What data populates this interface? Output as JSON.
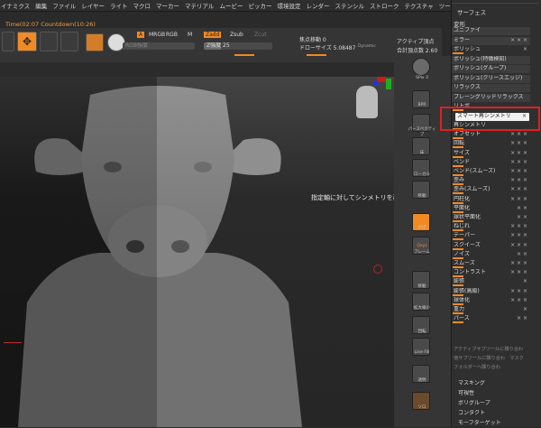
{
  "menubar": {
    "items": [
      "イナミクス",
      "編集",
      "ファイル",
      "レイヤー",
      "ライト",
      "マクロ",
      "マーカー",
      "マテリアル",
      "ムービー",
      "ピッカー",
      "環境設定",
      "レンダー",
      "ステンシル",
      "ストローク",
      "テクスチャ",
      "ツール"
    ]
  },
  "timer": "Time(02:07 Countdown(10:26)",
  "toolbar": {
    "a_label": "A",
    "mrgb": "MRGB",
    "rgb": "RGB",
    "m": "M",
    "zadd": "Zadd",
    "zsub": "Zsub",
    "zcut": "Zcut",
    "rgb_intensity": "RGB強度",
    "z_intensity": "Z強度 25",
    "z_intensity_value": 25,
    "focal_shift": "焦点移動 0",
    "focal_shift_value": 0,
    "draw_size": "ドローサイズ 5.08487",
    "draw_size_value": 5.08487,
    "dynamic": "Dynamic",
    "active_points": "アクティブ頂点",
    "total_points": "合計頂点数 2.60",
    "left_tools": [
      "Edit",
      "Move"
    ]
  },
  "shelf": {
    "spix": "SPix 3",
    "buttons": [
      "BPR",
      "パースペクティブ",
      "床",
      "ローカル",
      "移動",
      "XYZ",
      "フレーム",
      "移動",
      "拡大縮小",
      "回転",
      "Line Fill",
      "透明",
      "ソロ"
    ],
    "xyz_label": "Qxyz"
  },
  "tray": {
    "header": "サーフェス",
    "section": "変形",
    "items": [
      {
        "label": "ユニファイ",
        "style": "bar",
        "dots": ""
      },
      {
        "label": "ミラー",
        "style": "bar",
        "dots": "× × ×"
      },
      {
        "label": "ポリッシュ",
        "style": "plain",
        "dots": "×"
      },
      {
        "label": "ポリッシュ(特徴検知)",
        "style": "bar",
        "dots": ""
      },
      {
        "label": "ポリッシュ(グループ)",
        "style": "bar",
        "dots": ""
      },
      {
        "label": "ポリッシュ(クリースエッジ)",
        "style": "bar",
        "dots": ""
      },
      {
        "label": "リラックス",
        "style": "bar",
        "dots": ""
      },
      {
        "label": "プレーングリッドリラックス",
        "style": "bar",
        "dots": ""
      },
      {
        "label": "リトポ",
        "style": "plain",
        "dots": ""
      },
      {
        "label": "スマート再シンメトリ",
        "style": "highlight",
        "dots": "×"
      },
      {
        "label": "再シンメトリ",
        "style": "plain",
        "dots": ""
      },
      {
        "label": "オフセット",
        "style": "plain",
        "dots": "× × ×"
      },
      {
        "label": "回転",
        "style": "plain",
        "dots": "× × ×"
      },
      {
        "label": "サイズ",
        "style": "plain",
        "dots": "× × ×"
      },
      {
        "label": "ベンド",
        "style": "plain",
        "dots": "× × ×"
      },
      {
        "label": "ベンド(スムーズ)",
        "style": "plain",
        "dots": "× × ×"
      },
      {
        "label": "歪み",
        "style": "plain",
        "dots": "× × ×"
      },
      {
        "label": "歪み(スムーズ)",
        "style": "plain",
        "dots": "× × ×"
      },
      {
        "label": "円柱化",
        "style": "plain",
        "dots": "× × ×"
      },
      {
        "label": "平面化",
        "style": "plain",
        "dots": "× ×"
      },
      {
        "label": "球状平面化",
        "style": "plain",
        "dots": "× ×"
      },
      {
        "label": "ねじれ",
        "style": "plain",
        "dots": "× × ×"
      },
      {
        "label": "テーパー",
        "style": "plain",
        "dots": "× × ×"
      },
      {
        "label": "スクイーズ",
        "style": "plain",
        "dots": "× × ×"
      },
      {
        "label": "ノイズ",
        "style": "plain",
        "dots": "× ×"
      },
      {
        "label": "スムーズ",
        "style": "plain",
        "dots": "× × ×"
      },
      {
        "label": "コントラスト",
        "style": "plain",
        "dots": "× × ×"
      },
      {
        "label": "膨張",
        "style": "plain",
        "dots": "×"
      },
      {
        "label": "膨張(高級)",
        "style": "plain",
        "dots": "× × ×"
      },
      {
        "label": "球体化",
        "style": "plain",
        "dots": "× × ×"
      },
      {
        "label": "重力",
        "style": "plain",
        "dots": "×"
      },
      {
        "label": "パース",
        "style": "plain",
        "dots": "× ×"
      }
    ],
    "footer_dim": [
      "アクティブサブツールに隣り合わ",
      "他サブツールに隣り合わ　マスク",
      "フォルダーへ隣り合わ"
    ],
    "bottom": [
      "マスキング",
      "可視性",
      "ポリグループ",
      "コンタクト",
      "モーフターゲット"
    ]
  },
  "tooltip": "指定軸に対してシンメトリを再適用します",
  "colors": {
    "accent": "#f08a24",
    "highlight_box": "#e02020"
  }
}
